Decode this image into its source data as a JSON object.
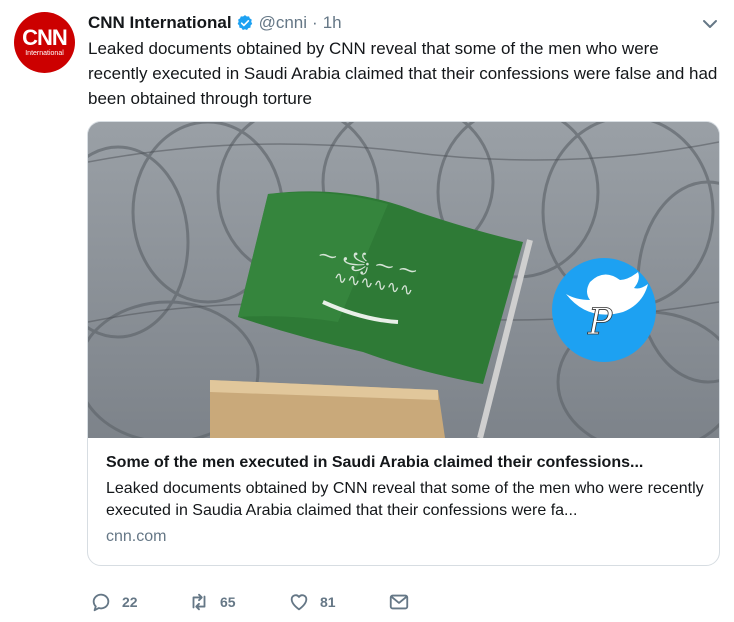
{
  "author": {
    "name": "CNN International",
    "handle": "@cnni",
    "separator": "·",
    "time": "1h",
    "avatar_logo": "CNN",
    "avatar_subtext": "International"
  },
  "tweet": {
    "text": "Leaked documents obtained by CNN reveal that some of the men who were recently executed in Saudi Arabia claimed that their confessions were false and had been obtained through torture"
  },
  "card": {
    "title": "Some of the men executed in Saudi Arabia claimed their confessions...",
    "description": "Leaked documents obtained by CNN reveal that some of the men who were recently executed in Saudia Arabia claimed that their confessions were fa...",
    "domain": "cnn.com",
    "watermark_letter": "P"
  },
  "actions": {
    "replies": "22",
    "retweets": "65",
    "likes": "81"
  },
  "icons": {
    "verified": "verified-badge-icon",
    "caret": "chevron-down-icon",
    "reply": "reply-icon",
    "retweet": "retweet-icon",
    "like": "heart-icon",
    "dm": "envelope-icon"
  },
  "colors": {
    "brand_red": "#cc0000",
    "twitter_blue": "#1da1f2",
    "text": "#14171a",
    "muted": "#657786",
    "flag_green": "#2e7a36"
  }
}
